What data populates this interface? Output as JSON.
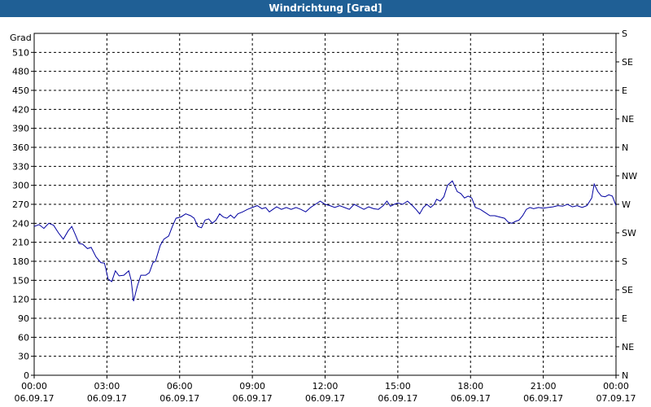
{
  "window": {
    "title": "Windrichtung [Grad]"
  },
  "chart_data": {
    "type": "line",
    "title": "Windrichtung [Grad]",
    "ylabel": "Grad",
    "xlabel": "",
    "ylim": [
      0,
      540
    ],
    "y_ticks": [
      0,
      30,
      60,
      90,
      120,
      150,
      180,
      210,
      240,
      270,
      300,
      330,
      360,
      390,
      420,
      450,
      480,
      510
    ],
    "y2_ticks": [
      {
        "value": 0,
        "label": "N"
      },
      {
        "value": 45,
        "label": "NE"
      },
      {
        "value": 90,
        "label": "E"
      },
      {
        "value": 135,
        "label": "SE"
      },
      {
        "value": 180,
        "label": "S"
      },
      {
        "value": 225,
        "label": "SW"
      },
      {
        "value": 270,
        "label": "W"
      },
      {
        "value": 315,
        "label": "NW"
      },
      {
        "value": 360,
        "label": "N"
      },
      {
        "value": 405,
        "label": "NE"
      },
      {
        "value": 450,
        "label": "E"
      },
      {
        "value": 495,
        "label": "SE"
      },
      {
        "value": 540,
        "label": "S"
      }
    ],
    "xlim": [
      0,
      24
    ],
    "x_ticks": [
      {
        "value": 0,
        "time": "00:00",
        "date": "06.09.17"
      },
      {
        "value": 3,
        "time": "03:00",
        "date": "06.09.17"
      },
      {
        "value": 6,
        "time": "06:00",
        "date": "06.09.17"
      },
      {
        "value": 9,
        "time": "09:00",
        "date": "06.09.17"
      },
      {
        "value": 12,
        "time": "12:00",
        "date": "06.09.17"
      },
      {
        "value": 15,
        "time": "15:00",
        "date": "06.09.17"
      },
      {
        "value": 18,
        "time": "18:00",
        "date": "06.09.17"
      },
      {
        "value": 21,
        "time": "21:00",
        "date": "06.09.17"
      },
      {
        "value": 24,
        "time": "00:00",
        "date": "07.09.17"
      }
    ],
    "grid": true,
    "series": [
      {
        "color": "#0000a0",
        "points": [
          [
            0.0,
            235
          ],
          [
            0.2,
            238
          ],
          [
            0.4,
            232
          ],
          [
            0.6,
            240
          ],
          [
            0.8,
            237
          ],
          [
            1.0,
            225
          ],
          [
            1.2,
            215
          ],
          [
            1.4,
            228
          ],
          [
            1.55,
            235
          ],
          [
            1.7,
            222
          ],
          [
            1.85,
            208
          ],
          [
            2.0,
            207
          ],
          [
            2.2,
            200
          ],
          [
            2.35,
            202
          ],
          [
            2.55,
            187
          ],
          [
            2.75,
            178
          ],
          [
            2.9,
            177
          ],
          [
            3.05,
            152
          ],
          [
            3.2,
            148
          ],
          [
            3.35,
            165
          ],
          [
            3.5,
            157
          ],
          [
            3.7,
            158
          ],
          [
            3.9,
            165
          ],
          [
            4.0,
            150
          ],
          [
            4.1,
            117
          ],
          [
            4.25,
            140
          ],
          [
            4.4,
            158
          ],
          [
            4.6,
            158
          ],
          [
            4.75,
            162
          ],
          [
            4.9,
            178
          ],
          [
            5.0,
            180
          ],
          [
            5.2,
            205
          ],
          [
            5.35,
            215
          ],
          [
            5.55,
            220
          ],
          [
            5.7,
            235
          ],
          [
            5.85,
            248
          ],
          [
            6.05,
            250
          ],
          [
            6.25,
            255
          ],
          [
            6.45,
            252
          ],
          [
            6.6,
            248
          ],
          [
            6.75,
            235
          ],
          [
            6.9,
            233
          ],
          [
            7.05,
            245
          ],
          [
            7.2,
            247
          ],
          [
            7.35,
            240
          ],
          [
            7.5,
            245
          ],
          [
            7.65,
            255
          ],
          [
            7.8,
            250
          ],
          [
            7.95,
            248
          ],
          [
            8.1,
            253
          ],
          [
            8.25,
            248
          ],
          [
            8.4,
            255
          ],
          [
            8.6,
            258
          ],
          [
            8.8,
            262
          ],
          [
            9.0,
            265
          ],
          [
            9.2,
            268
          ],
          [
            9.4,
            263
          ],
          [
            9.55,
            265
          ],
          [
            9.7,
            258
          ],
          [
            9.85,
            262
          ],
          [
            10.0,
            266
          ],
          [
            10.2,
            262
          ],
          [
            10.4,
            265
          ],
          [
            10.6,
            262
          ],
          [
            10.8,
            265
          ],
          [
            11.0,
            262
          ],
          [
            11.2,
            258
          ],
          [
            11.4,
            265
          ],
          [
            11.6,
            270
          ],
          [
            11.8,
            275
          ],
          [
            12.0,
            270
          ],
          [
            12.2,
            268
          ],
          [
            12.4,
            265
          ],
          [
            12.6,
            268
          ],
          [
            12.8,
            265
          ],
          [
            13.0,
            262
          ],
          [
            13.2,
            270
          ],
          [
            13.4,
            266
          ],
          [
            13.6,
            262
          ],
          [
            13.8,
            266
          ],
          [
            14.0,
            263
          ],
          [
            14.2,
            262
          ],
          [
            14.4,
            268
          ],
          [
            14.55,
            275
          ],
          [
            14.7,
            267
          ],
          [
            14.85,
            270
          ],
          [
            15.0,
            272
          ],
          [
            15.2,
            270
          ],
          [
            15.4,
            275
          ],
          [
            15.6,
            268
          ],
          [
            15.75,
            262
          ],
          [
            15.9,
            255
          ],
          [
            16.05,
            265
          ],
          [
            16.2,
            270
          ],
          [
            16.35,
            265
          ],
          [
            16.5,
            270
          ],
          [
            16.6,
            278
          ],
          [
            16.75,
            275
          ],
          [
            16.9,
            282
          ],
          [
            17.05,
            300
          ],
          [
            17.25,
            307
          ],
          [
            17.45,
            290
          ],
          [
            17.6,
            287
          ],
          [
            17.75,
            280
          ],
          [
            17.9,
            283
          ],
          [
            18.05,
            280
          ],
          [
            18.2,
            265
          ],
          [
            18.4,
            262
          ],
          [
            18.6,
            257
          ],
          [
            18.8,
            252
          ],
          [
            19.0,
            252
          ],
          [
            19.2,
            250
          ],
          [
            19.4,
            248
          ],
          [
            19.55,
            242
          ],
          [
            19.7,
            240
          ],
          [
            19.85,
            243
          ],
          [
            20.0,
            245
          ],
          [
            20.15,
            252
          ],
          [
            20.3,
            262
          ],
          [
            20.45,
            265
          ],
          [
            20.6,
            263
          ],
          [
            20.8,
            265
          ],
          [
            21.0,
            264
          ],
          [
            21.2,
            265
          ],
          [
            21.4,
            266
          ],
          [
            21.6,
            268
          ],
          [
            21.8,
            267
          ],
          [
            22.0,
            270
          ],
          [
            22.2,
            266
          ],
          [
            22.4,
            268
          ],
          [
            22.6,
            265
          ],
          [
            22.8,
            268
          ],
          [
            23.0,
            280
          ],
          [
            23.1,
            302
          ],
          [
            23.25,
            290
          ],
          [
            23.4,
            283
          ],
          [
            23.55,
            282
          ],
          [
            23.7,
            285
          ],
          [
            23.85,
            283
          ],
          [
            24.0,
            268
          ]
        ]
      }
    ]
  }
}
